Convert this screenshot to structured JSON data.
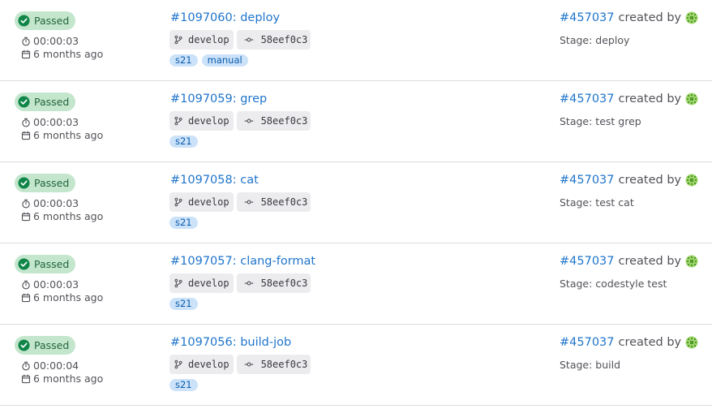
{
  "colors": {
    "passed_bg": "#c3e6cd",
    "passed_text": "#24663b",
    "link": "#1f75cb",
    "tag_bg": "#cbe2f9",
    "chip_bg": "#ececef"
  },
  "icons": {
    "status": "check-circle-icon",
    "duration": "timer-icon",
    "finished": "calendar-icon",
    "branch": "branch-icon",
    "commit": "commit-icon",
    "avatar": "identicon-avatar"
  },
  "jobs": [
    {
      "status": "Passed",
      "duration": "00:00:03",
      "finished": "6 months ago",
      "title": "#1097060: deploy",
      "branch": "develop",
      "commit": "58eef0c3",
      "tags": [
        "s21",
        "manual"
      ],
      "pipeline": "#457037",
      "created_by": "created by",
      "stage": "Stage: deploy"
    },
    {
      "status": "Passed",
      "duration": "00:00:03",
      "finished": "6 months ago",
      "title": "#1097059: grep",
      "branch": "develop",
      "commit": "58eef0c3",
      "tags": [
        "s21"
      ],
      "pipeline": "#457037",
      "created_by": "created by",
      "stage": "Stage: test grep"
    },
    {
      "status": "Passed",
      "duration": "00:00:03",
      "finished": "6 months ago",
      "title": "#1097058: cat",
      "branch": "develop",
      "commit": "58eef0c3",
      "tags": [
        "s21"
      ],
      "pipeline": "#457037",
      "created_by": "created by",
      "stage": "Stage: test cat"
    },
    {
      "status": "Passed",
      "duration": "00:00:03",
      "finished": "6 months ago",
      "title": "#1097057: clang-format",
      "branch": "develop",
      "commit": "58eef0c3",
      "tags": [
        "s21"
      ],
      "pipeline": "#457037",
      "created_by": "created by",
      "stage": "Stage: codestyle test"
    },
    {
      "status": "Passed",
      "duration": "00:00:04",
      "finished": "6 months ago",
      "title": "#1097056: build-job",
      "branch": "develop",
      "commit": "58eef0c3",
      "tags": [
        "s21"
      ],
      "pipeline": "#457037",
      "created_by": "created by",
      "stage": "Stage: build"
    }
  ]
}
